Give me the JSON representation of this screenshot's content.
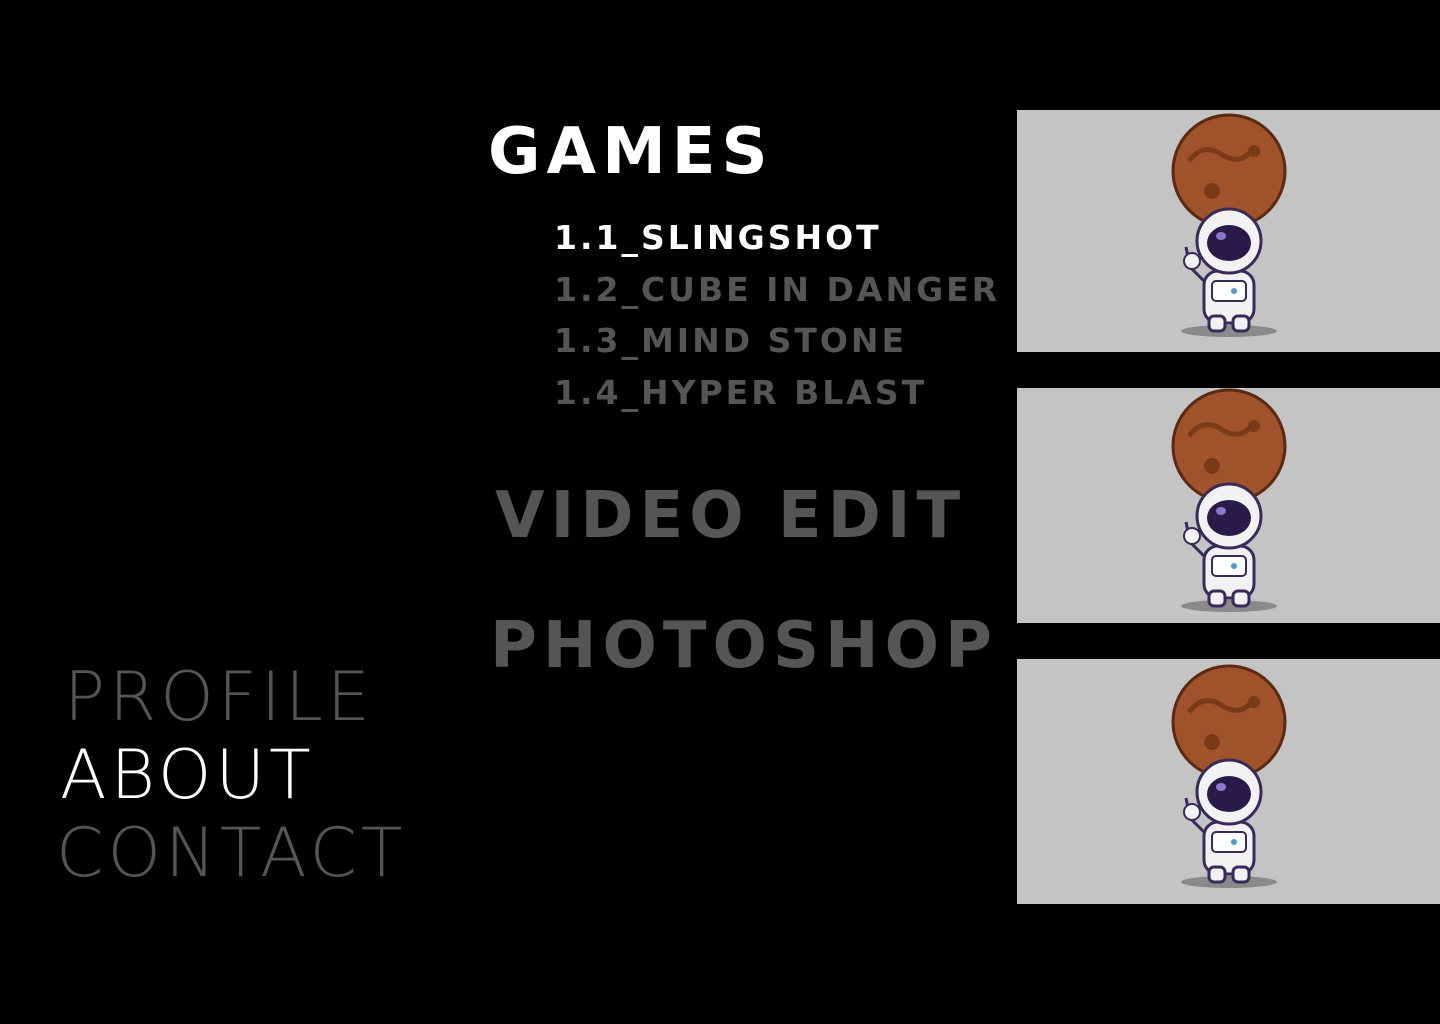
{
  "categories": [
    {
      "label": "GAMES",
      "color": "#ffffff"
    },
    {
      "label": "VIDEO EDIT",
      "color": "#555555"
    },
    {
      "label": "PHOTOSHOP",
      "color": "#555555"
    }
  ],
  "games": [
    {
      "label": "1.1_SLINGSHOT",
      "color": "#ffffff"
    },
    {
      "label": "1.2_CUBE IN DANGER",
      "color": "#555555"
    },
    {
      "label": "1.3_MIND STONE",
      "color": "#555555"
    },
    {
      "label": "1.4_HYPER BLAST",
      "color": "#555555"
    }
  ],
  "nav": [
    {
      "label": "PROFILE",
      "active": false
    },
    {
      "label": "ABOUT",
      "active": true
    },
    {
      "label": "CONTACT",
      "active": false
    }
  ],
  "thumbnails": [
    {
      "icon": "astronaut-planet-icon"
    },
    {
      "icon": "astronaut-planet-icon"
    },
    {
      "icon": "astronaut-planet-icon"
    }
  ],
  "colors": {
    "background": "#000000",
    "active": "#ffffff",
    "inactive": "#555555",
    "thumb_bg": "#c4c4c4"
  }
}
